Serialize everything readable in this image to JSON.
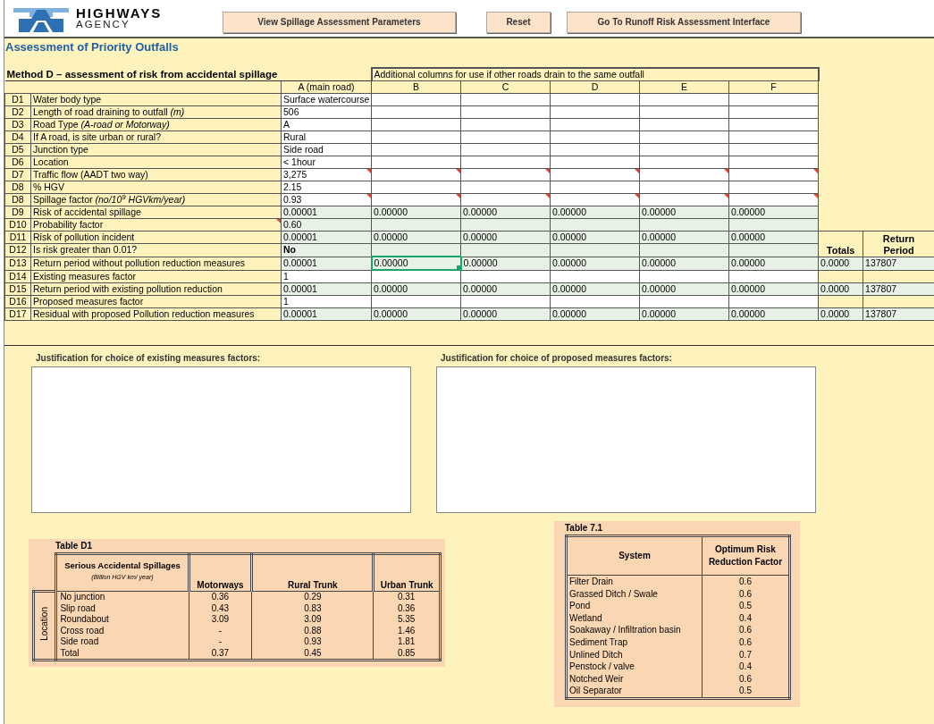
{
  "header": {
    "brand": "HIGHWAYS",
    "brand_sub": "AGENCY",
    "buttons": [
      "View  Spillage Assessment Parameters",
      "Reset",
      "Go To Runoff Risk Assessment Interface"
    ]
  },
  "title": "Assessment of Priority Outfalls",
  "method_table": {
    "heading": "Method D – assessment of risk from accidental spillage",
    "group_heading": "Additional columns for use if other roads drain to the same outfall",
    "columns": [
      "A (main road)",
      "B",
      "C",
      "D",
      "E",
      "F"
    ],
    "summary_headings": [
      "Totals",
      "Return Period"
    ],
    "rows": [
      {
        "code": "D1",
        "label": "Water body type",
        "kind": "input",
        "values": [
          {
            "text": "Surface watercourse",
            "selected": false
          },
          {
            "selected": false
          },
          {
            "selected": false
          },
          {
            "selected": false
          },
          {
            "selected": false
          },
          {
            "selected": false
          }
        ]
      },
      {
        "code": "D2",
        "label": "Length of road draining to outfall *(m)*",
        "kind": "input",
        "values": [
          {
            "text": "506",
            "selected": false
          },
          {
            "selected": false
          },
          {
            "selected": false
          },
          {
            "selected": false
          },
          {
            "selected": false
          },
          {
            "selected": false
          }
        ]
      },
      {
        "code": "D3",
        "label": "Road Type *(A-road or Motorway)*",
        "kind": "input",
        "values": [
          {
            "text": "A",
            "selected": false
          },
          {
            "selected": false
          },
          {
            "selected": false
          },
          {
            "selected": false
          },
          {
            "selected": false
          },
          {
            "selected": false
          }
        ]
      },
      {
        "code": "D4",
        "label": "If A road, is site urban or rural?",
        "kind": "input",
        "values": [
          {
            "text": "Rural",
            "selected": false
          },
          {
            "selected": false
          },
          {
            "selected": false
          },
          {
            "selected": false
          },
          {
            "selected": false
          },
          {
            "selected": false
          }
        ]
      },
      {
        "code": "D5",
        "label": "Junction type",
        "kind": "input",
        "values": [
          {
            "text": "Side road",
            "selected": false
          },
          {
            "selected": false
          },
          {
            "selected": false
          },
          {
            "selected": false
          },
          {
            "selected": false
          },
          {
            "selected": false
          }
        ]
      },
      {
        "code": "D6",
        "label": "Location",
        "kind": "input",
        "values": [
          {
            "text": "< 1hour",
            "selected": false
          },
          {
            "selected": false
          },
          {
            "selected": false
          },
          {
            "selected": false
          },
          {
            "selected": false
          },
          {
            "selected": false
          }
        ]
      },
      {
        "code": "D7",
        "label": "Traffic flow (AADT two way)",
        "kind": "input",
        "comment_marks": true,
        "values": [
          {
            "text": "3,275",
            "selected": false
          },
          {
            "selected": false
          },
          {
            "selected": false
          },
          {
            "selected": false
          },
          {
            "selected": false
          },
          {
            "selected": false
          }
        ]
      },
      {
        "code": "D8",
        "label": "% HGV",
        "kind": "input",
        "values": [
          {
            "text": "2.15",
            "selected": false
          },
          {
            "selected": false
          },
          {
            "selected": false
          },
          {
            "selected": false
          },
          {
            "selected": false
          },
          {
            "selected": false
          }
        ]
      },
      {
        "code": "D8",
        "label": "Spillage factor *(no/10$^{9}$ HGVkm/year)*",
        "kind": "input",
        "comment_marks": true,
        "values": [
          {
            "text": "0.93",
            "selected": false
          },
          {
            "selected": false
          },
          {
            "selected": false
          },
          {
            "selected": false
          },
          {
            "selected": false
          },
          {
            "selected": false
          }
        ]
      },
      {
        "code": "D9",
        "label": "Risk of accidental spillage",
        "kind": "calc",
        "values": [
          {
            "text": "0.00001",
            "selected": false
          },
          {
            "text": "0.00000",
            "selected": false
          },
          {
            "text": "0.00000",
            "selected": false
          },
          {
            "text": "0.00000",
            "selected": false
          },
          {
            "text": "0.00000",
            "selected": false
          },
          {
            "text": "0.00000",
            "selected": false
          }
        ]
      },
      {
        "code": "D10",
        "label": "Probability factor",
        "kind": "calc",
        "label_comment": true,
        "values": [
          {
            "text": "0.60",
            "selected": false
          },
          {
            "selected": false
          },
          {
            "selected": false
          },
          {
            "selected": false
          },
          {
            "selected": false
          },
          {
            "selected": false
          }
        ]
      },
      {
        "code": "D11",
        "label": "Risk of pollution incident",
        "kind": "calc",
        "values": [
          {
            "text": "0.00001",
            "selected": false
          },
          {
            "text": "0.00000",
            "selected": false
          },
          {
            "text": "0.00000",
            "selected": false
          },
          {
            "text": "0.00000",
            "selected": false
          },
          {
            "text": "0.00000",
            "selected": false
          },
          {
            "text": "0.00000",
            "selected": false
          }
        ]
      },
      {
        "code": "D12",
        "label": "Is risk greater than 0.01?",
        "kind": "verdict",
        "values": [
          {
            "text": "No",
            "selected": false
          },
          {
            "selected": false
          },
          {
            "selected": false
          },
          {
            "selected": false
          },
          {
            "selected": false
          },
          {
            "selected": false
          }
        ]
      },
      {
        "code": "D13",
        "label": "Return period without pollution reduction measures",
        "kind": "calc",
        "totals": "0.0000",
        "return_period": "137807",
        "values": [
          {
            "text": "0.00001",
            "selected": false
          },
          {
            "text": "0.00000",
            "selected": true
          },
          {
            "text": "0.00000",
            "selected": false
          },
          {
            "text": "0.00000",
            "selected": false
          },
          {
            "text": "0.00000",
            "selected": false
          },
          {
            "text": "0.00000",
            "selected": false
          }
        ]
      },
      {
        "code": "D14",
        "label": "Existing measures factor",
        "kind": "input",
        "values": [
          {
            "text": "1",
            "selected": false
          },
          {
            "selected": false
          },
          {
            "selected": false
          },
          {
            "selected": false
          },
          {
            "selected": false
          },
          {
            "selected": false
          }
        ]
      },
      {
        "code": "D15",
        "label": "Return period with existing pollution reduction",
        "kind": "calc",
        "totals": "0.0000",
        "return_period": "137807",
        "values": [
          {
            "text": "0.00001",
            "selected": false
          },
          {
            "text": "0.00000",
            "selected": false
          },
          {
            "text": "0.00000",
            "selected": false
          },
          {
            "text": "0.00000",
            "selected": false
          },
          {
            "text": "0.00000",
            "selected": false
          },
          {
            "text": "0.00000",
            "selected": false
          }
        ]
      },
      {
        "code": "D16",
        "label": "Proposed measures factor",
        "kind": "input",
        "values": [
          {
            "text": "1",
            "selected": false
          },
          {
            "selected": false
          },
          {
            "selected": false
          },
          {
            "selected": false
          },
          {
            "selected": false
          },
          {
            "selected": false
          }
        ]
      },
      {
        "code": "D17",
        "label": "Residual with proposed Pollution reduction measures",
        "kind": "calc",
        "totals": "0.0000",
        "return_period": "137807",
        "values": [
          {
            "text": "0.00001",
            "selected": false
          },
          {
            "text": "0.00000",
            "selected": false
          },
          {
            "text": "0.00000",
            "selected": false
          },
          {
            "text": "0.00000",
            "selected": false
          },
          {
            "text": "0.00000",
            "selected": false
          },
          {
            "text": "0.00000",
            "selected": false
          }
        ]
      }
    ]
  },
  "justifications": [
    {
      "label": "Justification for choice of existing measures factors:"
    },
    {
      "label": "Justification for choice of proposed measures factors:"
    }
  ],
  "table_d1": {
    "title": "Table D1",
    "heading": "Serious Accidental Spillages",
    "unit": "(Billion HGV km/ year)",
    "columns": [
      "Motorways",
      "Rural Trunk",
      "Urban Trunk"
    ],
    "side_label": "Location",
    "rows": [
      {
        "label": "No junction",
        "values": [
          "0.36",
          "0.29",
          "0.31"
        ]
      },
      {
        "label": "Slip road",
        "values": [
          "0.43",
          "0.83",
          "0.36"
        ]
      },
      {
        "label": "Roundabout",
        "values": [
          "3.09",
          "3.09",
          "5.35"
        ]
      },
      {
        "label": "Cross road",
        "values": [
          "-",
          "0.88",
          "1.46"
        ]
      },
      {
        "label": "Side road",
        "values": [
          "-",
          "0.93",
          "1.81"
        ]
      },
      {
        "label": "Total",
        "values": [
          "0.37",
          "0.45",
          "0.85"
        ]
      }
    ]
  },
  "table_7_1": {
    "title": "Table 7.1",
    "columns": [
      "System",
      "Optimum Risk Reduction Factor"
    ],
    "rows": [
      {
        "system": "Filter Drain",
        "factor": "0.6"
      },
      {
        "system": "Grassed Ditch / Swale",
        "factor": "0.6"
      },
      {
        "system": "Pond",
        "factor": "0.5"
      },
      {
        "system": "Wetland",
        "factor": "0.4"
      },
      {
        "system": "Soakaway / Infiltration basin",
        "factor": "0.6"
      },
      {
        "system": "Sediment Trap",
        "factor": "0.6"
      },
      {
        "system": "Unlined Ditch",
        "factor": "0.7"
      },
      {
        "system": "Penstock / valve",
        "factor": "0.4"
      },
      {
        "system": "Notched Weir",
        "factor": "0.6"
      },
      {
        "system": "Oil Separator",
        "factor": "0.5"
      }
    ]
  }
}
